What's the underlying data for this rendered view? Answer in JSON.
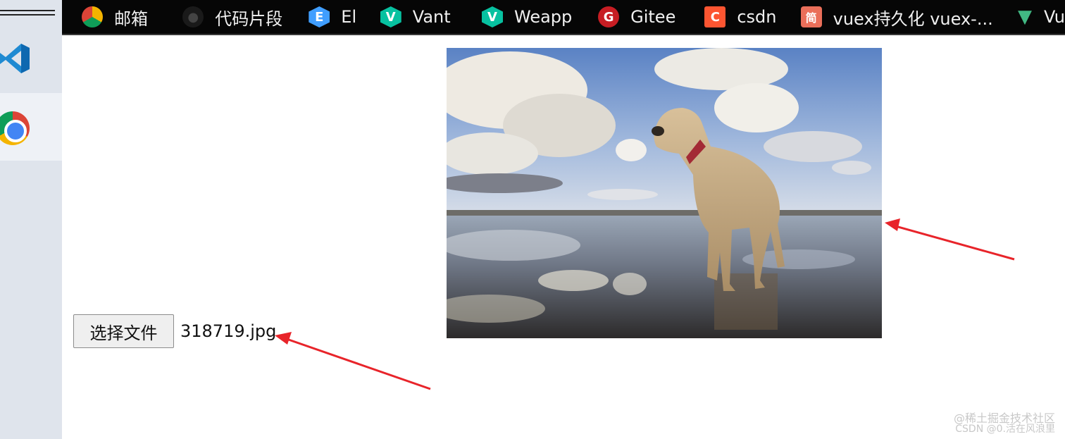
{
  "taskbar": {
    "apps": [
      {
        "name": "vscode-icon"
      },
      {
        "name": "chrome-icon"
      }
    ]
  },
  "bookmarks": [
    {
      "label": "邮箱",
      "icon_char": ""
    },
    {
      "label": "代码片段",
      "icon_char": "●"
    },
    {
      "label": "El",
      "icon_char": "E"
    },
    {
      "label": "Vant",
      "icon_char": "V"
    },
    {
      "label": "Weapp",
      "icon_char": "V"
    },
    {
      "label": "Gitee",
      "icon_char": "G"
    },
    {
      "label": "csdn",
      "icon_char": "C"
    },
    {
      "label": "vuex持久化 vuex-...",
      "icon_char": "简"
    },
    {
      "label": "Vu",
      "icon_char": "▼"
    }
  ],
  "page": {
    "file_button_label": "选择文件",
    "file_name": "318719.jpg"
  },
  "watermark": {
    "line1": "@稀土掘金技术社区",
    "line2": "CSDN @0.活在风浪里"
  },
  "colors": {
    "bookmark_bar_bg": "#060606",
    "annotation_arrow": "#e8242a"
  }
}
